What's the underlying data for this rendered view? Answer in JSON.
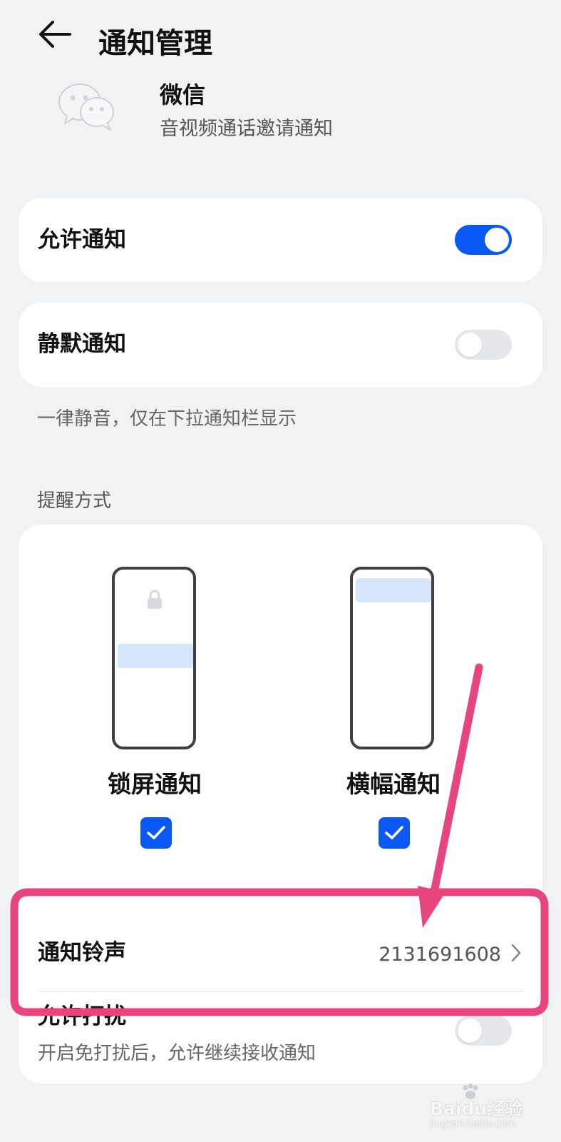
{
  "header": {
    "title": "通知管理"
  },
  "app": {
    "name": "微信",
    "channel": "音视频通话邀请通知",
    "icon": "wechat-icon"
  },
  "allow_notifications": {
    "label": "允许通知",
    "enabled": true
  },
  "silent_notifications": {
    "label": "静默通知",
    "enabled": false,
    "description": "一律静音，仅在下拉通知栏显示"
  },
  "reminder": {
    "section_label": "提醒方式",
    "options": [
      {
        "label": "锁屏通知",
        "checked": true
      },
      {
        "label": "横幅通知",
        "checked": true
      }
    ]
  },
  "ringtone": {
    "label": "通知铃声",
    "value": "2131691608"
  },
  "allow_disturb": {
    "label": "允许打扰",
    "description": "开启免打扰后，允许继续接收通知",
    "enabled": false
  },
  "watermark": {
    "text": "Baidu经验",
    "sub": "jingyan.baidu.com"
  },
  "colors": {
    "accent": "#0a59f7",
    "annotation": "#e8457f",
    "background": "#f1f2f4"
  }
}
